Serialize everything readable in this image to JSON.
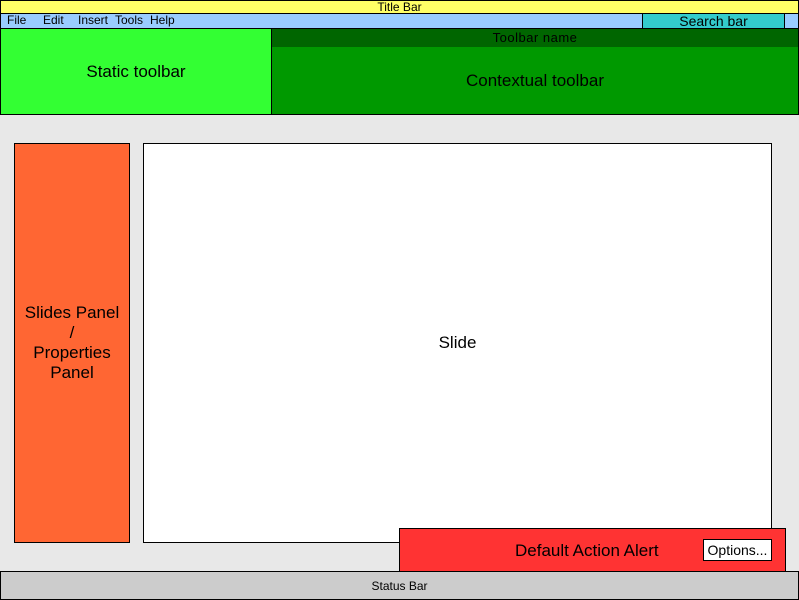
{
  "title_bar": {
    "label": "Title Bar",
    "color": "#ffff66"
  },
  "menu": {
    "items": [
      "File",
      "Edit",
      "Insert",
      "Tools",
      "Help"
    ],
    "color": "#99ccff"
  },
  "search": {
    "label": "Search bar",
    "color": "#33cccc"
  },
  "static_toolbar": {
    "label": "Static toolbar",
    "color": "#33ff33"
  },
  "contextual_toolbar": {
    "name": "Toolbar name",
    "label": "Contextual toolbar",
    "color": "#009900",
    "name_color": "#006600"
  },
  "side_panel": {
    "label": "Slides Panel\n/\nProperties\nPanel",
    "color": "#ff6633"
  },
  "slide": {
    "label": "Slide",
    "color": "#ffffff"
  },
  "alert": {
    "text": "Default Action Alert",
    "button_label": "Options...",
    "color": "#ff3333"
  },
  "status_bar": {
    "label": "Status Bar",
    "color": "#cccccc"
  }
}
